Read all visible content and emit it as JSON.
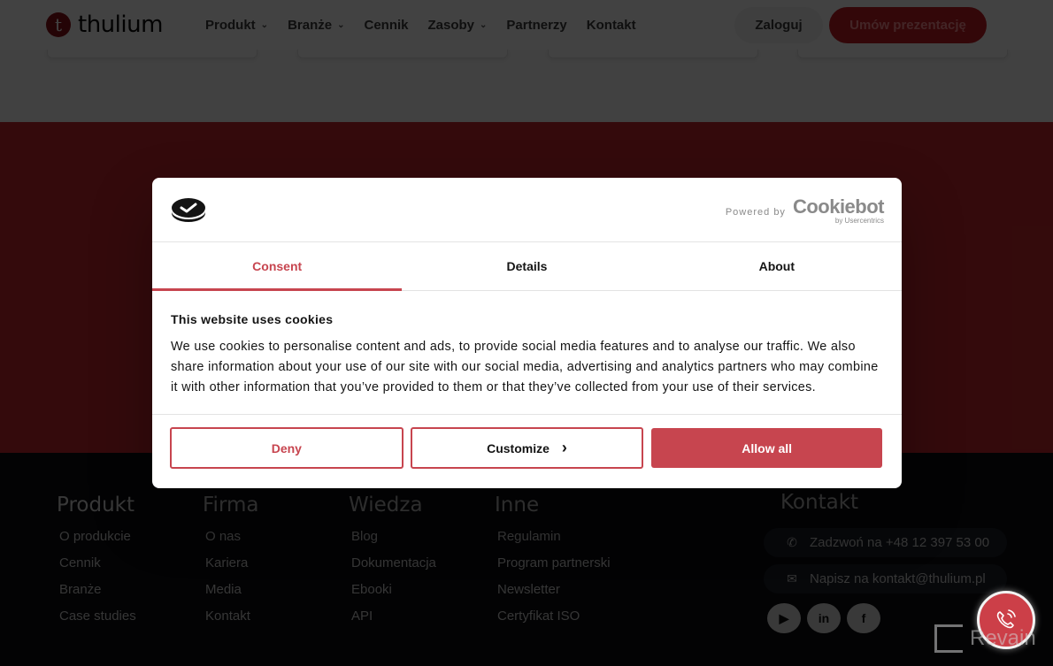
{
  "header": {
    "logo_mark": "t",
    "logo_text": "thulium",
    "nav": [
      {
        "label": "Produkt",
        "has_dropdown": true
      },
      {
        "label": "Branże",
        "has_dropdown": true
      },
      {
        "label": "Cennik",
        "has_dropdown": false
      },
      {
        "label": "Zasoby",
        "has_dropdown": true
      },
      {
        "label": "Partnerzy",
        "has_dropdown": false
      },
      {
        "label": "Kontakt",
        "has_dropdown": false
      }
    ],
    "chevron_glyph": "⌄",
    "login_label": "Zaloguj",
    "demo_label": "Umów prezentację"
  },
  "cookie_dialog": {
    "powered_by": "Powered by",
    "brand_name": "Cookiebot",
    "brand_sub": "by Usercentrics",
    "tabs": [
      {
        "label": "Consent",
        "active": true
      },
      {
        "label": "Details",
        "active": false
      },
      {
        "label": "About",
        "active": false
      }
    ],
    "title": "This website uses cookies",
    "text": "We use cookies to personalise content and ads, to provide social media features and to analyse our traffic. We also share information about your use of our site with our social media, advertising and analytics partners who may combine it with other information that you’ve provided to them or that they’ve collected from your use of their services.",
    "buttons": {
      "deny": "Deny",
      "customize": "Customize",
      "customize_chevron": "›",
      "allow_all": "Allow all"
    }
  },
  "footer": {
    "columns": [
      {
        "title": "Produkt",
        "links": [
          "O produkcie",
          "Cennik",
          "Branże",
          "Case studies"
        ]
      },
      {
        "title": "Firma",
        "links": [
          "O nas",
          "Kariera",
          "Media",
          "Kontakt"
        ]
      },
      {
        "title": "Wiedza",
        "links": [
          "Blog",
          "Dokumentacja",
          "Ebooki",
          "API"
        ]
      },
      {
        "title": "Inne",
        "links": [
          "Regulamin",
          "Program partnerski",
          "Newsletter",
          "Certyfikat ISO"
        ]
      }
    ],
    "contact": {
      "title": "Kontakt",
      "phone": "Zadzwoń na +48 12 397 53 00",
      "email": "Napisz na kontakt@thulium.pl",
      "phone_icon": "✆",
      "email_icon": "✉"
    },
    "social": [
      {
        "name": "youtube",
        "glyph": "▶"
      },
      {
        "name": "linkedin",
        "glyph": "in"
      },
      {
        "name": "facebook",
        "glyph": "f"
      }
    ]
  },
  "watermark": {
    "text": "Revain"
  },
  "colors": {
    "brand_red": "#c41e26",
    "cookie_accent": "#c7454f",
    "footer_bg": "#0c0d12"
  }
}
